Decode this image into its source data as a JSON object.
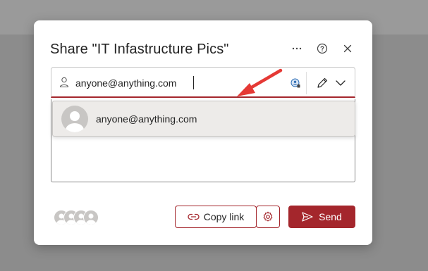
{
  "dialog": {
    "title": "Share \"IT Infastructure Pics\""
  },
  "header_icons": {
    "more": "more-icon",
    "help": "help-icon",
    "close": "close-icon"
  },
  "people_field": {
    "value": "anyone@anything.com",
    "person_icon": "person-icon",
    "lookup_icon": "contact-lookup-icon",
    "permission_icon": "pencil-icon",
    "dropdown_icon": "chevron-down-icon"
  },
  "suggestion": {
    "email": "anyone@anything.com"
  },
  "footer": {
    "copy_link_label": "Copy link",
    "send_label": "Send",
    "settings_icon": "gear-icon",
    "link_icon": "link-icon",
    "send_icon": "send-icon"
  },
  "colors": {
    "accent": "#a4262c",
    "annotation_arrow": "#e53935",
    "dialog_bg": "#ffffff",
    "suggestion_bg": "#edebe9"
  }
}
